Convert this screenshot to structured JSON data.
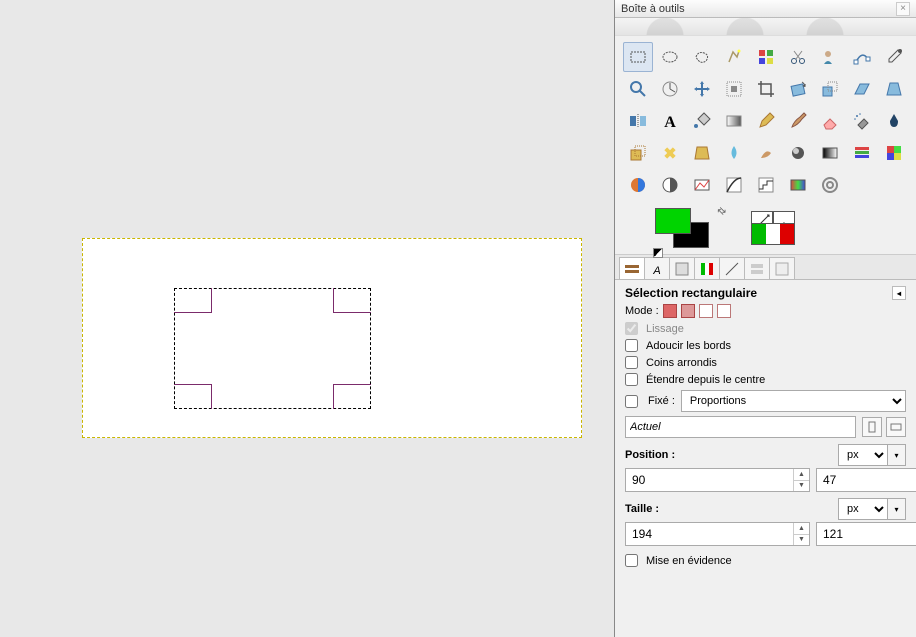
{
  "panel": {
    "title": "Boîte à outils"
  },
  "options": {
    "title": "Sélection rectangulaire",
    "mode_label": "Mode :",
    "lissage_label": "Lissage",
    "adoucir_label": "Adoucir les bords",
    "coins_label": "Coins arrondis",
    "etendre_label": "Étendre depuis le centre",
    "fixe_label": "Fixé :",
    "fixe_value": "Proportions",
    "actuel_label": "Actuel",
    "position_label": "Position :",
    "taille_label": "Taille :",
    "unit": "px",
    "position_x": "90",
    "position_y": "47",
    "taille_w": "194",
    "taille_h": "121",
    "mise_label": "Mise en évidence"
  },
  "colors": {
    "fg": "#00d400",
    "bg": "#000000"
  },
  "tools": [
    "rect-select",
    "ellipse-select",
    "free-select",
    "fuzzy-select",
    "color-select",
    "scissors",
    "foreground-select",
    "paths",
    "eyedropper",
    "zoom",
    "measure",
    "move",
    "align",
    "crop",
    "rotate",
    "scale",
    "shear",
    "perspective",
    "flip",
    "text",
    "bucket-fill",
    "gradient",
    "pencil",
    "paintbrush",
    "eraser",
    "airbrush",
    "ink",
    "clone",
    "heal",
    "perspective-clone",
    "blur",
    "smudge",
    "dodge",
    "color-balance",
    "hue-sat",
    "colorize",
    "brightness",
    "threshold",
    "levels",
    "curves",
    "posterize",
    "desaturate",
    "gegl"
  ]
}
